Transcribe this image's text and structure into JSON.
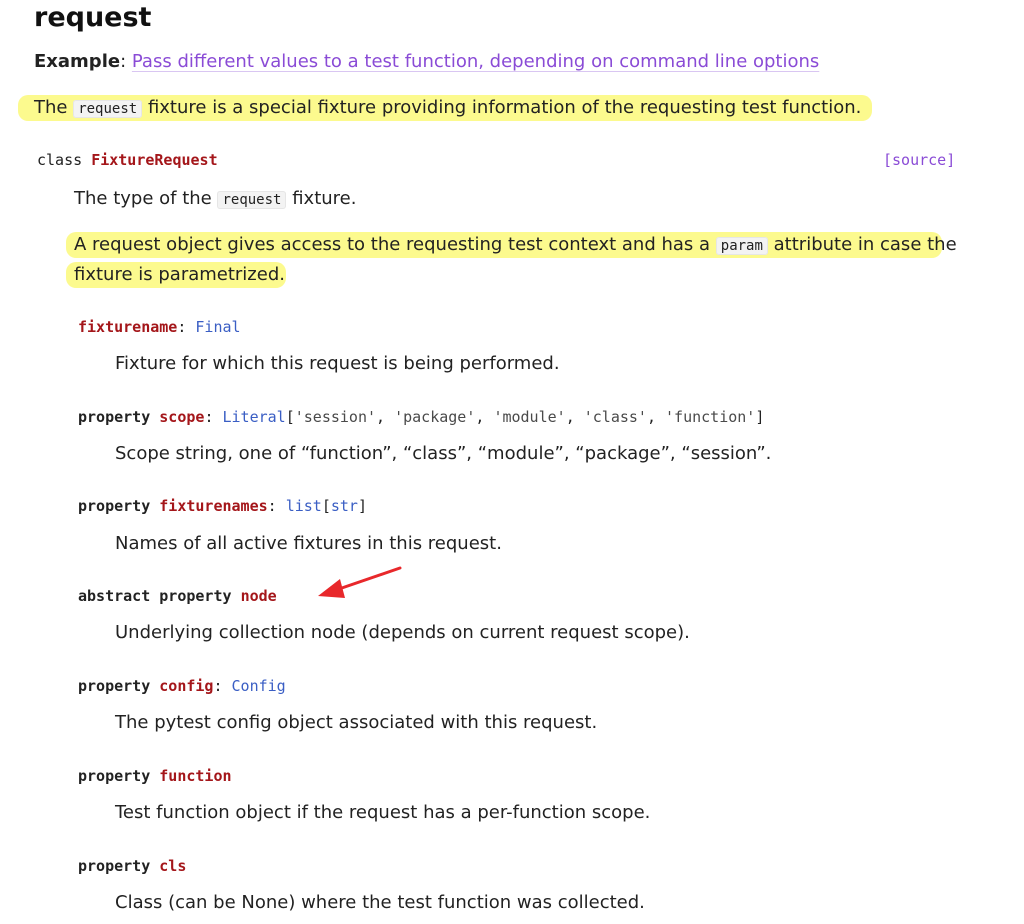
{
  "heading": "request",
  "example": {
    "label": "Example",
    "sep": ":",
    "link_text": "Pass different values to a test function, depending on command line options"
  },
  "intro": {
    "before": "The ",
    "code": "request",
    "after": " fixture is a special fixture providing information of the requesting test function."
  },
  "class_sig": {
    "keyword": "class",
    "name": "FixtureRequest",
    "source_label": "[source]"
  },
  "class_desc1": {
    "before": "The type of the ",
    "code": "request",
    "after": " fixture."
  },
  "class_desc2": {
    "before": "A request object gives access to the requesting test context and has a ",
    "code": "param",
    "after": " attribute in case the",
    "line2": "fixture is parametrized."
  },
  "members": [
    {
      "prefix": "",
      "name": "fixturename",
      "colon": ": ",
      "type": "Final",
      "desc": "Fixture for which this request is being performed."
    },
    {
      "prefix": "property ",
      "name": "scope",
      "colon": ": ",
      "type": "Literal",
      "literal_parts": [
        "[",
        "'session'",
        ", ",
        "'package'",
        ", ",
        "'module'",
        ", ",
        "'class'",
        ", ",
        "'function'",
        "]"
      ],
      "desc": "Scope string, one of “function”, “class”, “module”, “package”, “session”."
    },
    {
      "prefix": "property ",
      "name": "fixturenames",
      "colon": ": ",
      "type": "list",
      "type_bracket_open": "[",
      "type_inner": "str",
      "type_bracket_close": "]",
      "desc": "Names of all active fixtures in this request."
    },
    {
      "prefix": "abstract property ",
      "name": "node",
      "desc": "Underlying collection node (depends on current request scope)."
    },
    {
      "prefix": "property ",
      "name": "config",
      "colon": ": ",
      "type": "Config",
      "desc": "The pytest config object associated with this request."
    },
    {
      "prefix": "property ",
      "name": "function",
      "desc": "Test function object if the request has a per-function scope."
    },
    {
      "prefix": "property ",
      "name": "cls",
      "desc": "Class (can be None) where the test function was collected."
    }
  ],
  "colors": {
    "name": "#a4161a",
    "type": "#3a5ec4",
    "link": "#8a4bd6",
    "highlight": "#fbf97a",
    "annotation_arrow": "#e8282b"
  },
  "annotation": {
    "icon": "red-arrow-icon"
  }
}
